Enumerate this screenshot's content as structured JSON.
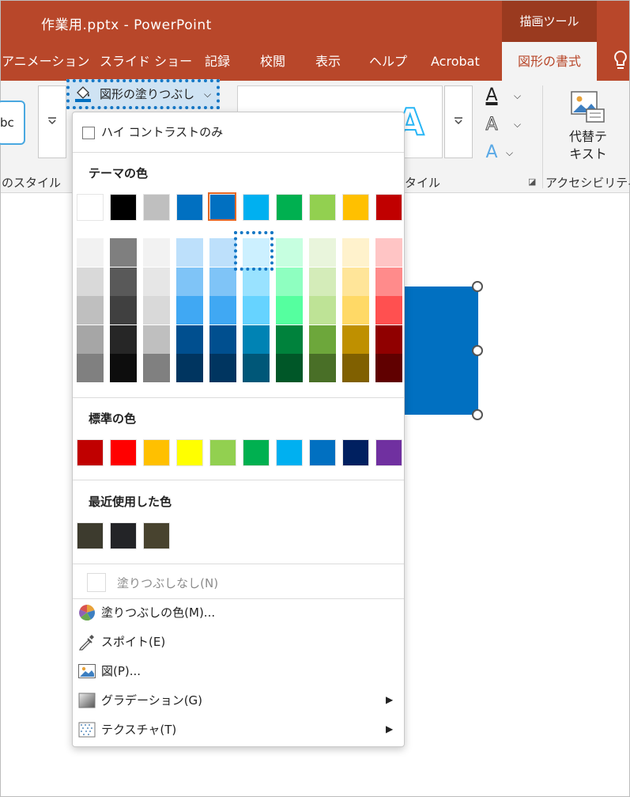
{
  "app": {
    "title": "作業用.pptx  -  PowerPoint",
    "context_header": "描画ツール"
  },
  "tabs": [
    {
      "label": "アニメーション"
    },
    {
      "label": "スライド ショー"
    },
    {
      "label": "記録"
    },
    {
      "label": "校閲"
    },
    {
      "label": "表示"
    },
    {
      "label": "ヘルプ"
    },
    {
      "label": "Acrobat"
    },
    {
      "label": "図形の書式",
      "active": true
    }
  ],
  "ribbon": {
    "style_preview": "bc",
    "shape_fill_label": "図形の塗りつぶし",
    "shape_fill_chevron": "⌵",
    "group_shape_styles": "のスタイル",
    "group_wordart_styles": "タイル",
    "group_accessibility": "アクセシビリティ",
    "alt_text_label_line1": "代替テ",
    "alt_text_label_line2": "キスト",
    "wordart_preview": "A",
    "text_fill_glyph": "A",
    "text_outline_glyph": "A",
    "text_effects_glyph": "A"
  },
  "dropdown": {
    "high_contrast_label": "ハイ コントラストのみ",
    "theme_colors_title": "テーマの色",
    "theme_colors": [
      "#ffffff",
      "#000000",
      "#bfbfbf",
      "#0170c1",
      "#0170c1",
      "#00b0f0",
      "#00b050",
      "#92d050",
      "#ffc000",
      "#c00000"
    ],
    "theme_tints": [
      [
        "#f2f2f2",
        "#d9d9d9",
        "#bfbfbf",
        "#a6a6a6",
        "#808080"
      ],
      [
        "#7f7f7f",
        "#595959",
        "#404040",
        "#262626",
        "#0d0d0d"
      ],
      [
        "#f2f2f2",
        "#e6e6e6",
        "#d9d9d9",
        "#bfbfbf",
        "#808080"
      ],
      [
        "#bde0fb",
        "#7fc4f7",
        "#40a8f3",
        "#004f8f",
        "#003560"
      ],
      [
        "#bde0fb",
        "#7fc4f7",
        "#40a8f3",
        "#004f8f",
        "#003560"
      ],
      [
        "#ccf0ff",
        "#99e2ff",
        "#66d3ff",
        "#0083b4",
        "#005778"
      ],
      [
        "#c6ffe0",
        "#8effc0",
        "#55ff9f",
        "#00823c",
        "#005728"
      ],
      [
        "#e9f5dc",
        "#d4ecb9",
        "#bee396",
        "#6da73b",
        "#496f27"
      ],
      [
        "#fff2cc",
        "#ffe599",
        "#ffd966",
        "#bf9000",
        "#806000"
      ],
      [
        "#ffc5c5",
        "#ff8b8b",
        "#ff5050",
        "#900000",
        "#600000"
      ]
    ],
    "standard_colors_title": "標準の色",
    "standard_colors": [
      "#c00000",
      "#ff0000",
      "#ffc000",
      "#ffff00",
      "#92d050",
      "#00b050",
      "#00b0f0",
      "#0170c1",
      "#002060",
      "#7030a0"
    ],
    "recent_colors_title": "最近使用した色",
    "recent_colors": [
      "#3d3b2e",
      "#232427",
      "#48432f"
    ],
    "no_fill_label": "塗りつぶしなし(N)",
    "menu": [
      {
        "label": "塗りつぶしの色(M)...",
        "icon": "color-wheel-icon",
        "submenu": false
      },
      {
        "label": "スポイト(E)",
        "icon": "eyedropper-icon",
        "submenu": false
      },
      {
        "label": "図(P)...",
        "icon": "picture-icon",
        "submenu": false
      },
      {
        "label": "グラデーション(G)",
        "icon": "gradient-icon",
        "submenu": true
      },
      {
        "label": "テクスチャ(T)",
        "icon": "texture-icon",
        "submenu": true
      }
    ],
    "submenu_arrow": "▶"
  },
  "colors": {
    "accent_red": "#b8472a",
    "selection_blue": "#1577c5",
    "slide_shape_fill": "#0170c1"
  }
}
